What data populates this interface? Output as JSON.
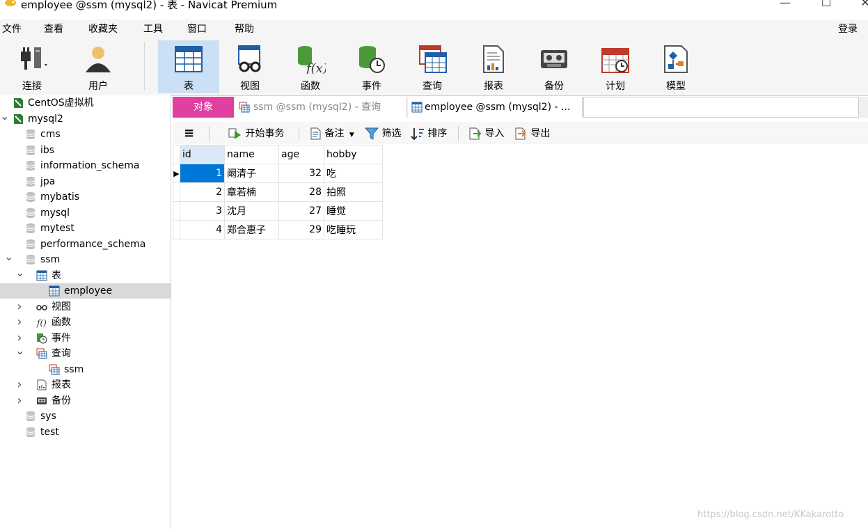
{
  "window": {
    "title": "employee @ssm (mysql2) - 表 - Navicat Premium",
    "minimize": "—",
    "maximize": "☐",
    "close": "✕"
  },
  "menu": {
    "items": [
      "文件",
      "查看",
      "收藏夹",
      "工具",
      "窗口",
      "帮助"
    ],
    "login": "登录"
  },
  "toolbar": {
    "connect": "连接",
    "user": "用户",
    "tools": [
      {
        "label": "表",
        "icon": "table-icon"
      },
      {
        "label": "视图",
        "icon": "view-icon"
      },
      {
        "label": "函数",
        "icon": "function-icon"
      },
      {
        "label": "事件",
        "icon": "event-icon"
      },
      {
        "label": "查询",
        "icon": "query-icon"
      },
      {
        "label": "报表",
        "icon": "report-icon"
      },
      {
        "label": "备份",
        "icon": "backup-icon"
      },
      {
        "label": "计划",
        "icon": "schedule-icon"
      },
      {
        "label": "模型",
        "icon": "model-icon"
      }
    ]
  },
  "sidebar": {
    "items": [
      {
        "label": "CentOS虚拟机",
        "icon": "connection-icon"
      },
      {
        "label": "mysql2",
        "icon": "connection-icon",
        "expanded": true
      },
      {
        "label": "cms",
        "icon": "database-icon"
      },
      {
        "label": "ibs",
        "icon": "database-icon"
      },
      {
        "label": "information_schema",
        "icon": "database-icon"
      },
      {
        "label": "jpa",
        "icon": "database-icon"
      },
      {
        "label": "mybatis",
        "icon": "database-icon"
      },
      {
        "label": "mysql",
        "icon": "database-icon"
      },
      {
        "label": "mytest",
        "icon": "database-icon"
      },
      {
        "label": "performance_schema",
        "icon": "database-icon"
      },
      {
        "label": "ssm",
        "icon": "database-icon",
        "expanded": true
      },
      {
        "label": "表",
        "icon": "table-icon",
        "expanded": true
      },
      {
        "label": "employee",
        "icon": "table-icon",
        "selected": true
      },
      {
        "label": "视图",
        "icon": "view-icon"
      },
      {
        "label": "函数",
        "icon": "function-icon"
      },
      {
        "label": "事件",
        "icon": "event-icon"
      },
      {
        "label": "查询",
        "icon": "query-icon",
        "expanded": true
      },
      {
        "label": "ssm",
        "icon": "query-icon"
      },
      {
        "label": "报表",
        "icon": "report-icon"
      },
      {
        "label": "备份",
        "icon": "backup-icon"
      },
      {
        "label": "sys",
        "icon": "database-icon"
      },
      {
        "label": "test",
        "icon": "database-icon"
      }
    ]
  },
  "tabs": [
    {
      "label": "对象",
      "active": true
    },
    {
      "label": "ssm @ssm (mysql2) - 查询"
    },
    {
      "label": "employee @ssm (mysql2) - ..."
    }
  ],
  "subtoolbar": {
    "menu": "≡",
    "begin": "开始事务",
    "remark": "备注",
    "filter": "筛选",
    "sort": "排序",
    "import": "导入",
    "export": "导出"
  },
  "grid": {
    "columns": [
      "id",
      "name",
      "age",
      "hobby"
    ],
    "rows": [
      [
        "1",
        "阚清子",
        "32",
        "吃"
      ],
      [
        "2",
        "章若楠",
        "28",
        "拍照"
      ],
      [
        "3",
        "沈月",
        "27",
        "睡觉"
      ],
      [
        "4",
        "郑合惠子",
        "29",
        "吃睡玩"
      ]
    ]
  },
  "watermark": "https://blog.csdn.net/KKakarotto",
  "colors": {
    "accent": "#0078d7",
    "tab_active": "#e040a0",
    "selected_tool": "#cce0f5"
  }
}
